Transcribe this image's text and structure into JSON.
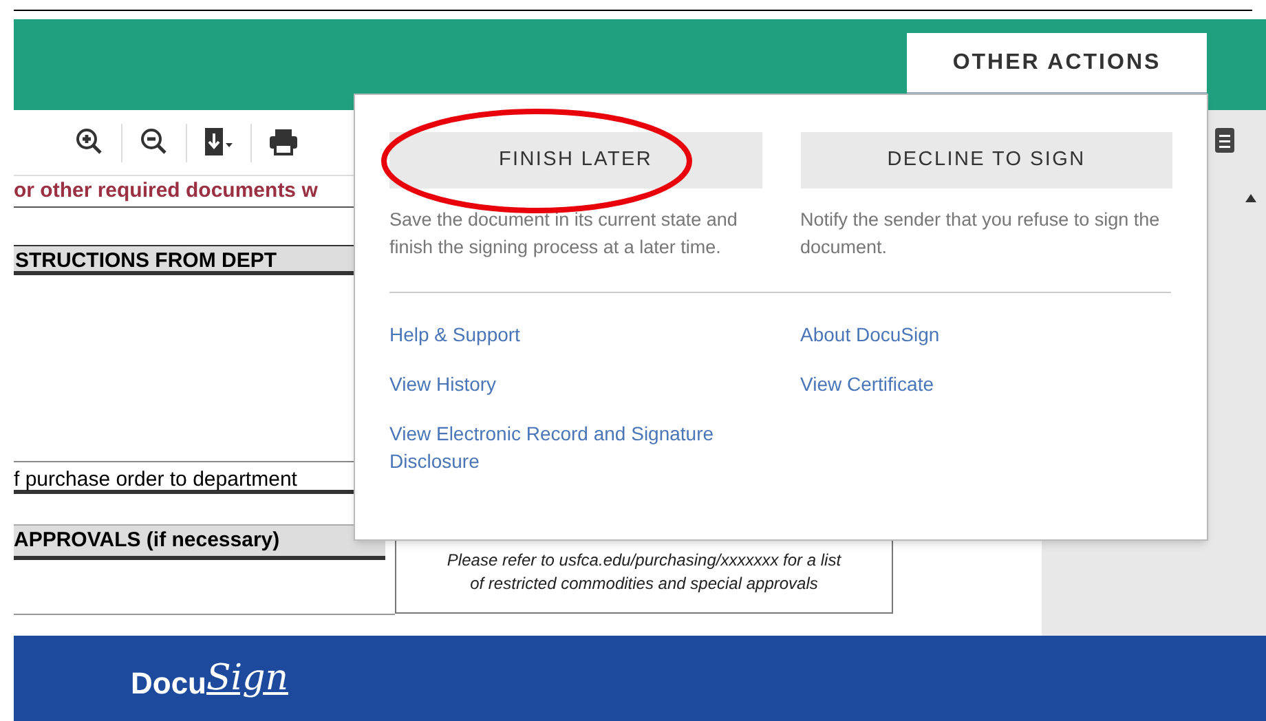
{
  "header": {
    "tab": {
      "label": "OTHER ACTIONS",
      "selected": true
    }
  },
  "toolbar": {
    "tools": [
      {
        "kind": "zoom-in"
      },
      {
        "kind": "zoom-out"
      },
      {
        "kind": "download"
      },
      {
        "kind": "print"
      }
    ]
  },
  "document": {
    "notice": "or other required documents w",
    "section_1": "STRUCTIONS FROM DEPT",
    "line_1": "f purchase order to department",
    "section_2": "APPROVALS (if necessary)",
    "note": [
      "Please refer to usfca.edu/purchasing/xxxxxxx for a list",
      "of restricted commodities and special approvals"
    ]
  },
  "menu": {
    "actions": [
      {
        "label": "FINISH LATER",
        "description": "Save the document in its current state and finish the signing process at a later time.",
        "highlighted": true
      },
      {
        "label": "DECLINE TO SIGN",
        "description": "Notify the sender that you refuse to sign the document.",
        "highlighted": false
      }
    ],
    "links": [
      [
        "Help & Support",
        "View History",
        "View Electronic Record and Signature Disclosure"
      ],
      [
        "About DocuSign",
        "View Certificate"
      ]
    ]
  },
  "footer": {
    "logo": [
      "Docu",
      "Sign"
    ]
  }
}
